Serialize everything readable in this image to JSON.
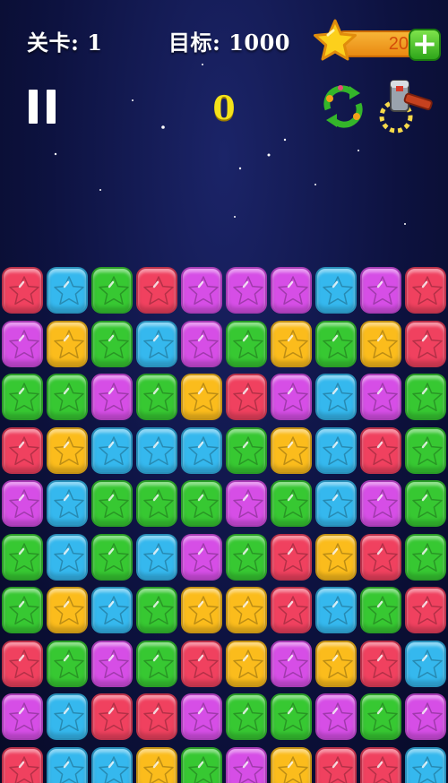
{
  "hud": {
    "level_text": "关卡: 1",
    "target_text": "目标: 1000",
    "coins": "20",
    "plus_label": "+",
    "score": "0"
  },
  "icons": {
    "pause": "pause-icon",
    "refresh": "refresh-icon",
    "hammer": "hammer-icon",
    "coin_star": "star-icon"
  },
  "colors": {
    "R": "#f0415f",
    "B": "#35b8ee",
    "G": "#37c832",
    "P": "#d64ee6",
    "Y": "#fbbc1c"
  },
  "board": {
    "rows": [
      [
        "R",
        "B",
        "G",
        "R",
        "P",
        "P",
        "P",
        "B",
        "P",
        "R"
      ],
      [
        "P",
        "Y",
        "G",
        "B",
        "P",
        "G",
        "Y",
        "G",
        "Y",
        "R"
      ],
      [
        "G",
        "G",
        "P",
        "G",
        "Y",
        "R",
        "P",
        "B",
        "P",
        "G"
      ],
      [
        "R",
        "Y",
        "B",
        "B",
        "B",
        "G",
        "Y",
        "B",
        "R",
        "G"
      ],
      [
        "P",
        "B",
        "G",
        "G",
        "G",
        "P",
        "G",
        "B",
        "P",
        "G"
      ],
      [
        "G",
        "B",
        "G",
        "B",
        "P",
        "G",
        "R",
        "Y",
        "R",
        "G"
      ],
      [
        "G",
        "Y",
        "B",
        "G",
        "Y",
        "Y",
        "R",
        "B",
        "G",
        "R"
      ],
      [
        "R",
        "G",
        "P",
        "G",
        "R",
        "Y",
        "P",
        "Y",
        "R",
        "B"
      ],
      [
        "P",
        "B",
        "R",
        "R",
        "P",
        "G",
        "G",
        "P",
        "G",
        "P"
      ],
      [
        "R",
        "B",
        "B",
        "Y",
        "G",
        "P",
        "Y",
        "R",
        "R",
        "B"
      ]
    ]
  }
}
